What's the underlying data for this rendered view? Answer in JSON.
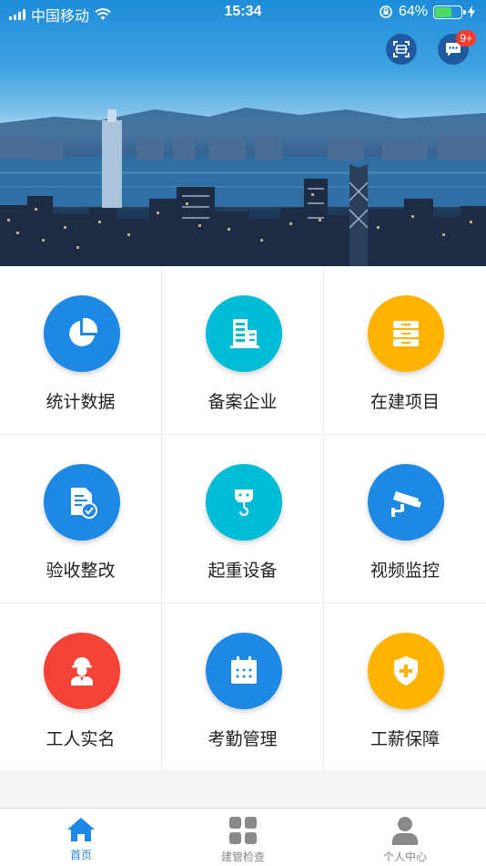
{
  "status_bar": {
    "carrier": "中国移动",
    "time": "15:34",
    "battery_percent": "64%",
    "battery_level": 0.64
  },
  "header": {
    "message_badge": "9+"
  },
  "menu": [
    {
      "label": "统计数据",
      "icon": "pie-chart-icon",
      "color": "#1e88e5"
    },
    {
      "label": "备案企业",
      "icon": "building-icon",
      "color": "#00bcd4"
    },
    {
      "label": "在建项目",
      "icon": "archive-box-icon",
      "color": "#ffb300"
    },
    {
      "label": "验收整改",
      "icon": "document-check-icon",
      "color": "#1e88e5"
    },
    {
      "label": "起重设备",
      "icon": "crane-hook-icon",
      "color": "#00bcd4"
    },
    {
      "label": "视频监控",
      "icon": "security-camera-icon",
      "color": "#1e88e5"
    },
    {
      "label": "工人实名",
      "icon": "worker-icon",
      "color": "#f44336"
    },
    {
      "label": "考勤管理",
      "icon": "calendar-icon",
      "color": "#1e88e5"
    },
    {
      "label": "工薪保障",
      "icon": "shield-plus-icon",
      "color": "#ffb300"
    }
  ],
  "tabs": [
    {
      "label": "首页",
      "icon": "home-icon",
      "active": true
    },
    {
      "label": "建管检查",
      "icon": "grid-icon",
      "active": false
    },
    {
      "label": "个人中心",
      "icon": "person-icon",
      "active": false
    }
  ]
}
